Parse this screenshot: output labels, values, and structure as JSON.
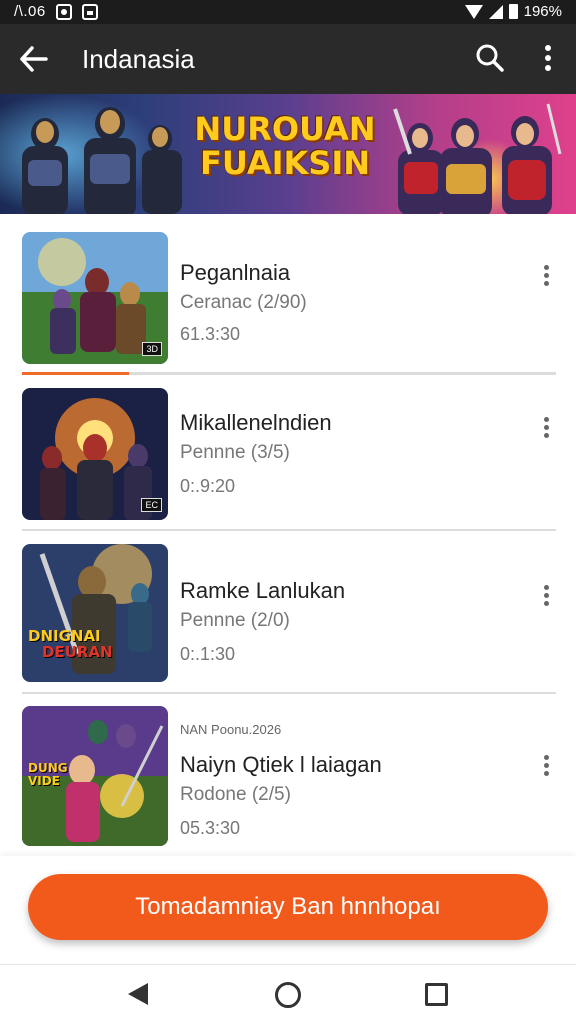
{
  "status_bar": {
    "time": "/\\.06",
    "battery_text": "196%"
  },
  "app_bar": {
    "title": "Indanasia"
  },
  "banner": {
    "title_line1": "NUROUAN",
    "title_line2": "FUAIKSIN"
  },
  "items": [
    {
      "title": "Peganlnaia",
      "subtitle": "Ceranac (2/90)",
      "meta": "61.3:30",
      "badge": "3D",
      "tag": ""
    },
    {
      "title": "Mikallenelndien",
      "subtitle": "Pennne (3/5)",
      "meta": "0:.9:20",
      "badge": "EC",
      "tag": ""
    },
    {
      "title": "Ramke Lanlukan",
      "subtitle": "Pennne (2/0)",
      "meta": "0:.1:30",
      "badge": "",
      "tag": "",
      "thumb_text_1": "DNIGNAI",
      "thumb_text_2": "DEURAN"
    },
    {
      "title": "Naiyn Qtiek l laiagan",
      "subtitle": "Rodone (2/5)",
      "meta": "05.3:30",
      "badge": "",
      "tag": "NAN Poonu.2026",
      "thumb_text_1": "DUNG VIDE"
    }
  ],
  "progress": {
    "first_item_fraction": 0.2
  },
  "cta": {
    "label": "Tomadamniay Ban hnnhopaı"
  },
  "colors": {
    "accent": "#f25a1c",
    "app_bar": "#2a2a2a",
    "status_bar": "#1c1c1c"
  },
  "icons": [
    "back-arrow-icon",
    "search-icon",
    "more-vert-icon",
    "nav-back-icon",
    "nav-home-icon",
    "nav-recent-icon"
  ]
}
